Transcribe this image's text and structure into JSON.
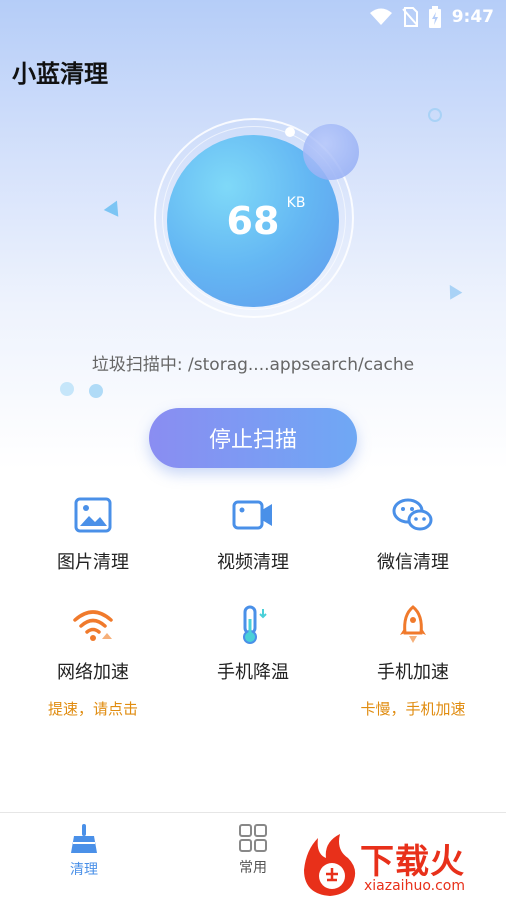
{
  "status_bar": {
    "time": "9:47",
    "icons": [
      "wifi-icon",
      "no-sim-icon",
      "battery-charging-icon"
    ]
  },
  "app": {
    "title": "小蓝清理"
  },
  "scan": {
    "size_value": "68",
    "size_unit": "KB",
    "path_text": "垃圾扫描中: /storag....appsearch/cache",
    "stop_label": "停止扫描"
  },
  "features": [
    {
      "label": "图片清理",
      "icon": "image-icon",
      "color": "#4a90e8"
    },
    {
      "label": "视频清理",
      "icon": "video-icon",
      "color": "#4a90e8"
    },
    {
      "label": "微信清理",
      "icon": "wechat-icon",
      "color": "#4a90e8"
    },
    {
      "label": "网络加速",
      "icon": "wifi-speed-icon",
      "color": "#f07a2c",
      "sub": "提速，请点击"
    },
    {
      "label": "手机降温",
      "icon": "thermometer-icon",
      "color": "#4a90e8"
    },
    {
      "label": "手机加速",
      "icon": "rocket-icon",
      "color": "#f07a2c",
      "sub": "卡慢，手机加速"
    }
  ],
  "nav": [
    {
      "label": "清理",
      "icon": "broom-icon",
      "active": true
    },
    {
      "label": "常用",
      "icon": "grid-icon",
      "active": false
    }
  ],
  "watermark": {
    "text": "下载火",
    "sub": "xiazaihuo.com"
  },
  "colors": {
    "accent": "#4a90e8",
    "orange": "#f07a2c",
    "sub_text": "#e08c10",
    "button_start": "#8a8df2",
    "button_end": "#6fa8f4"
  }
}
